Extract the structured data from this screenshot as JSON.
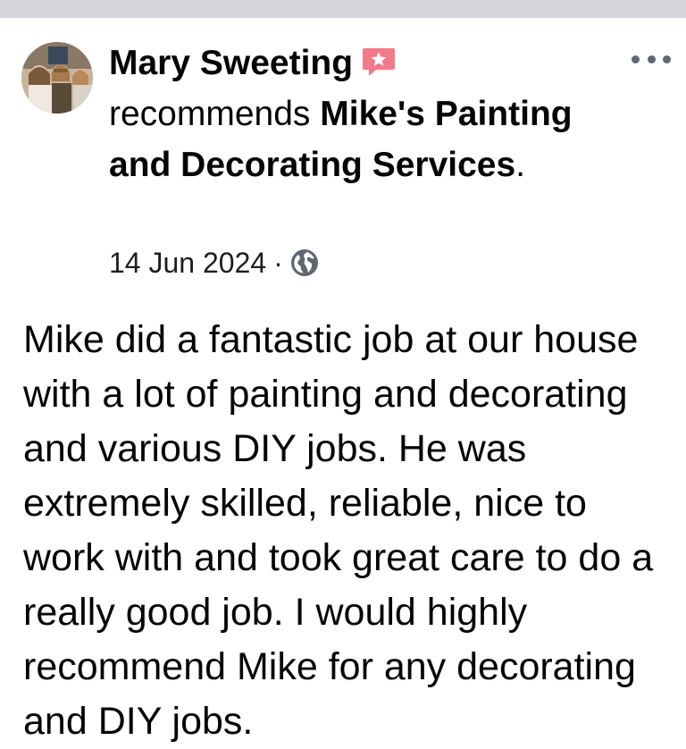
{
  "post": {
    "author": "Mary Sweeting",
    "action": "recommends",
    "page_name": "Mike's Painting and Decorating Services",
    "punctuation": ".",
    "date": "14 Jun 2024",
    "separator": "·",
    "audience_icon": "globe-icon",
    "recommend_icon": "recommendation-badge-icon",
    "menu_icon": "more-options-icon",
    "body": "Mike did a fantastic job at our house with a lot of painting and decorating and various DIY jobs. He was extremely skilled, reliable, nice to work with and took great care to do a really good job. I would highly recommend Mike for any decorating and DIY jobs."
  },
  "colors": {
    "badge_red": "#f02849",
    "meta_gray": "#606770",
    "divider_gray": "#d3d5da"
  }
}
